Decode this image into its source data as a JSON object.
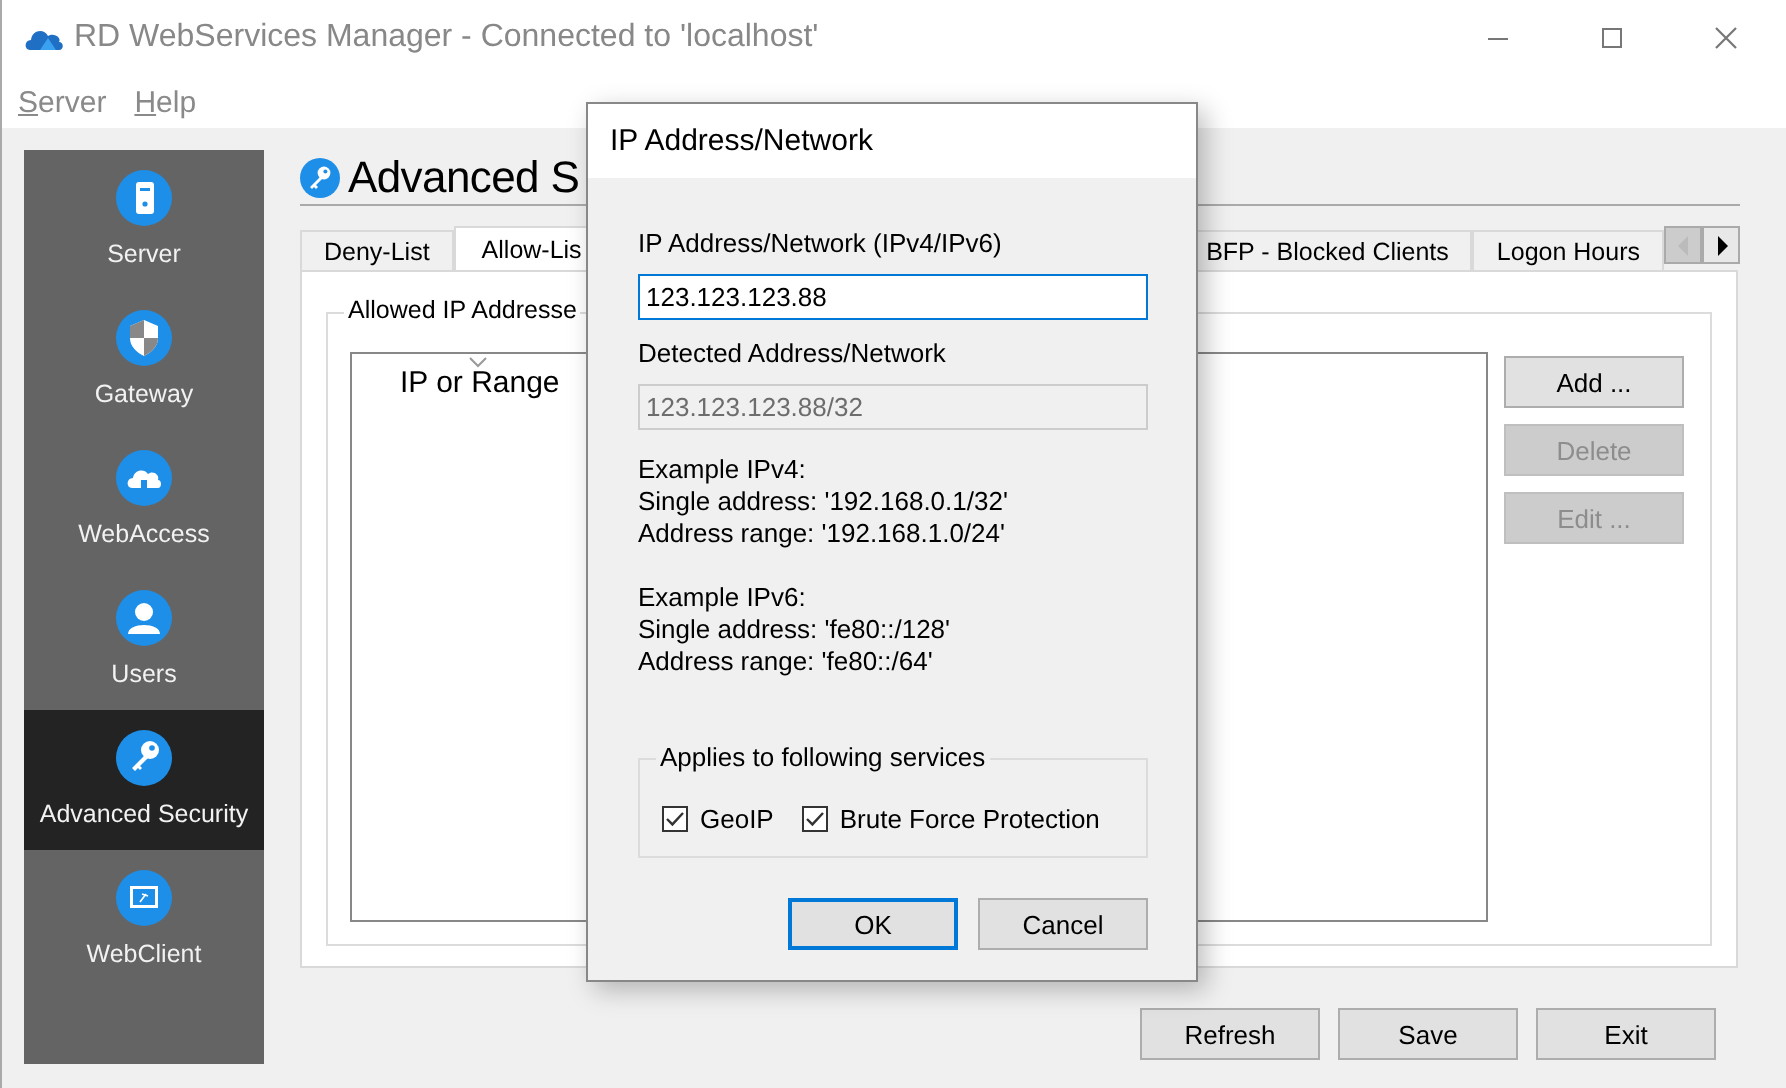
{
  "window": {
    "title": "RD WebServices Manager - Connected to 'localhost'"
  },
  "menu": [
    {
      "label": "Server"
    },
    {
      "label": "Help"
    }
  ],
  "sidebar": {
    "items": [
      {
        "label": "Server",
        "selected": false
      },
      {
        "label": "Gateway",
        "selected": false
      },
      {
        "label": "WebAccess",
        "selected": false
      },
      {
        "label": "Users",
        "selected": false
      },
      {
        "label": "Advanced Security",
        "selected": true
      },
      {
        "label": "WebClient",
        "selected": false
      }
    ]
  },
  "page": {
    "title": "Advanced S"
  },
  "tabs": [
    {
      "label": "Deny-List",
      "selected": false
    },
    {
      "label": "Allow-Lis",
      "selected": true
    },
    {
      "label": "BFP - Blocked Clients",
      "selected": false
    },
    {
      "label": "Logon Hours",
      "selected": false
    }
  ],
  "group": {
    "title": "Allowed IP Addresse"
  },
  "list": {
    "columns": [
      "IP or Range"
    ]
  },
  "side_buttons": [
    {
      "label": "Add ...",
      "disabled": false
    },
    {
      "label": "Delete",
      "disabled": true
    },
    {
      "label": "Edit ...",
      "disabled": true
    }
  ],
  "footer_buttons": [
    {
      "label": "Refresh"
    },
    {
      "label": "Save"
    },
    {
      "label": "Exit"
    }
  ],
  "dialog": {
    "title": "IP Address/Network",
    "address_label": "IP Address/Network (IPv4/IPv6)",
    "address_value": "123.123.123.88",
    "detected_label": "Detected Address/Network",
    "detected_value": "123.123.123.88/32",
    "examples": [
      {
        "heading": "Example IPv4:",
        "lines": [
          "Single address: '192.168.0.1/32'",
          "Address range: '192.168.1.0/24'"
        ]
      },
      {
        "heading": "Example IPv6:",
        "lines": [
          "Single address: 'fe80::/128'",
          "Address range: 'fe80::/64'"
        ]
      }
    ],
    "services": {
      "title": "Applies to following services",
      "options": [
        {
          "label": "GeoIP",
          "checked": true
        },
        {
          "label": "Brute Force Protection",
          "checked": true
        }
      ]
    },
    "buttons": [
      {
        "label": "OK",
        "default": true
      },
      {
        "label": "Cancel",
        "default": false
      }
    ]
  }
}
